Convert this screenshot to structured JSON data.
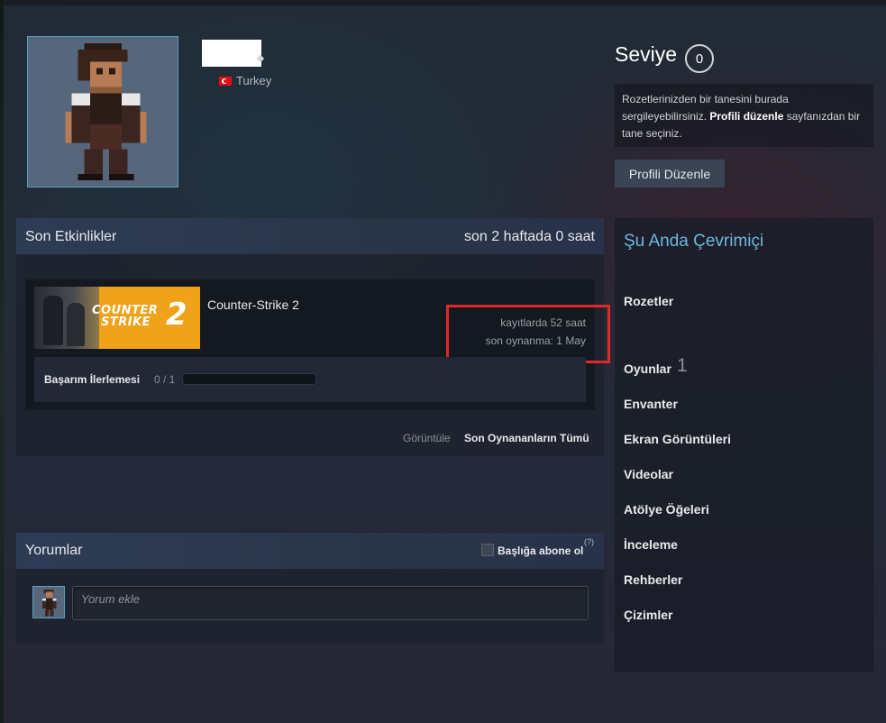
{
  "profile": {
    "country": "Turkey"
  },
  "level": {
    "label": "Seviye",
    "value": "0"
  },
  "badge_showcase": {
    "text_part1": "Rozetlerinizden bir tanesini burada sergileyebilirsiniz.",
    "link": "Profili düzenle",
    "text_part2": "sayfanızdan bir tane seçiniz."
  },
  "edit_profile_button": "Profili Düzenle",
  "recent_activity": {
    "title": "Son Etkinlikler",
    "hours_summary": "son 2 haftada 0 saat",
    "game": {
      "name": "Counter-Strike 2",
      "art_logo_line1": "COUNTER",
      "art_logo_line2": "STRIKE",
      "art_logo_num": "2",
      "hours_on_record": "kayıtlarda 52 saat",
      "last_played": "son oynanma: 1 May",
      "achievement_label": "Başarım İlerlemesi",
      "achievement_count": "0 / 1",
      "achievement_progress": 0
    },
    "view_label": "Görüntüle",
    "view_link": "Son Oynananların Tümü"
  },
  "comments": {
    "title": "Yorumlar",
    "subscribe_label": "Başlığa abone ol",
    "help": "(?)",
    "input_placeholder": "Yorum ekle"
  },
  "sidebar": {
    "online_status": "Şu Anda Çevrimiçi",
    "badges": "Rozetler",
    "games": "Oyunlar",
    "games_count": "1",
    "inventory": "Envanter",
    "screenshots": "Ekran Görüntüleri",
    "videos": "Videolar",
    "workshop": "Atölye Öğeleri",
    "reviews": "İnceleme",
    "guides": "Rehberler",
    "artwork": "Çizimler"
  },
  "colors": {
    "accent_blue": "#6ab9e0",
    "highlight_red": "#e02828"
  }
}
